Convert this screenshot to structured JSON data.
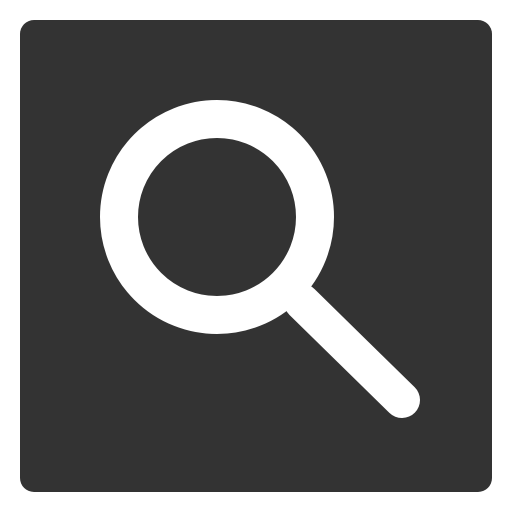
{
  "search_button": {
    "icon": "search-icon",
    "background_color": "#333333",
    "icon_color": "#ffffff"
  }
}
